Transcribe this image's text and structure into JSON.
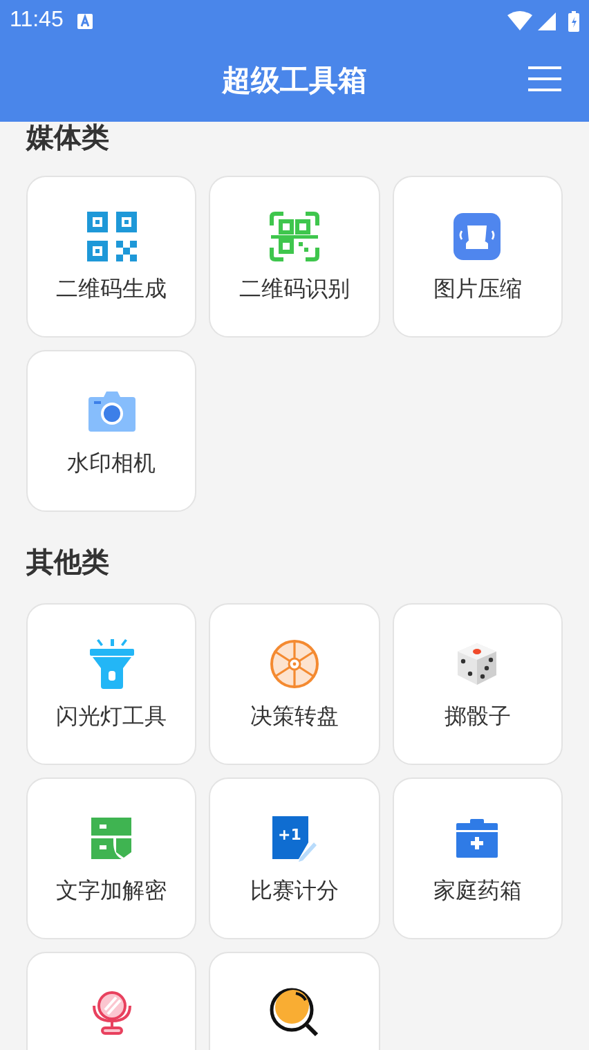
{
  "status_bar": {
    "time": "11:45"
  },
  "header": {
    "title": "超级工具箱"
  },
  "sections": [
    {
      "title": "媒体类",
      "tools": [
        {
          "label": "二维码生成",
          "kind": "qr"
        },
        {
          "label": "二维码识别",
          "kind": "qrscan"
        },
        {
          "label": "图片压缩",
          "kind": "image"
        },
        {
          "label": "水印相机",
          "kind": "camera"
        }
      ]
    },
    {
      "title": "其他类",
      "tools": [
        {
          "label": "闪光灯工具",
          "kind": "flashlight"
        },
        {
          "label": "决策转盘",
          "kind": "wheel"
        },
        {
          "label": "掷骰子",
          "kind": "dice"
        },
        {
          "label": "文字加解密",
          "kind": "encrypt"
        },
        {
          "label": "比赛计分",
          "kind": "score",
          "icon_text": "+1"
        },
        {
          "label": "家庭药箱",
          "kind": "medkit"
        },
        {
          "kind": "mirror"
        },
        {
          "kind": "magnifier"
        }
      ]
    }
  ]
}
